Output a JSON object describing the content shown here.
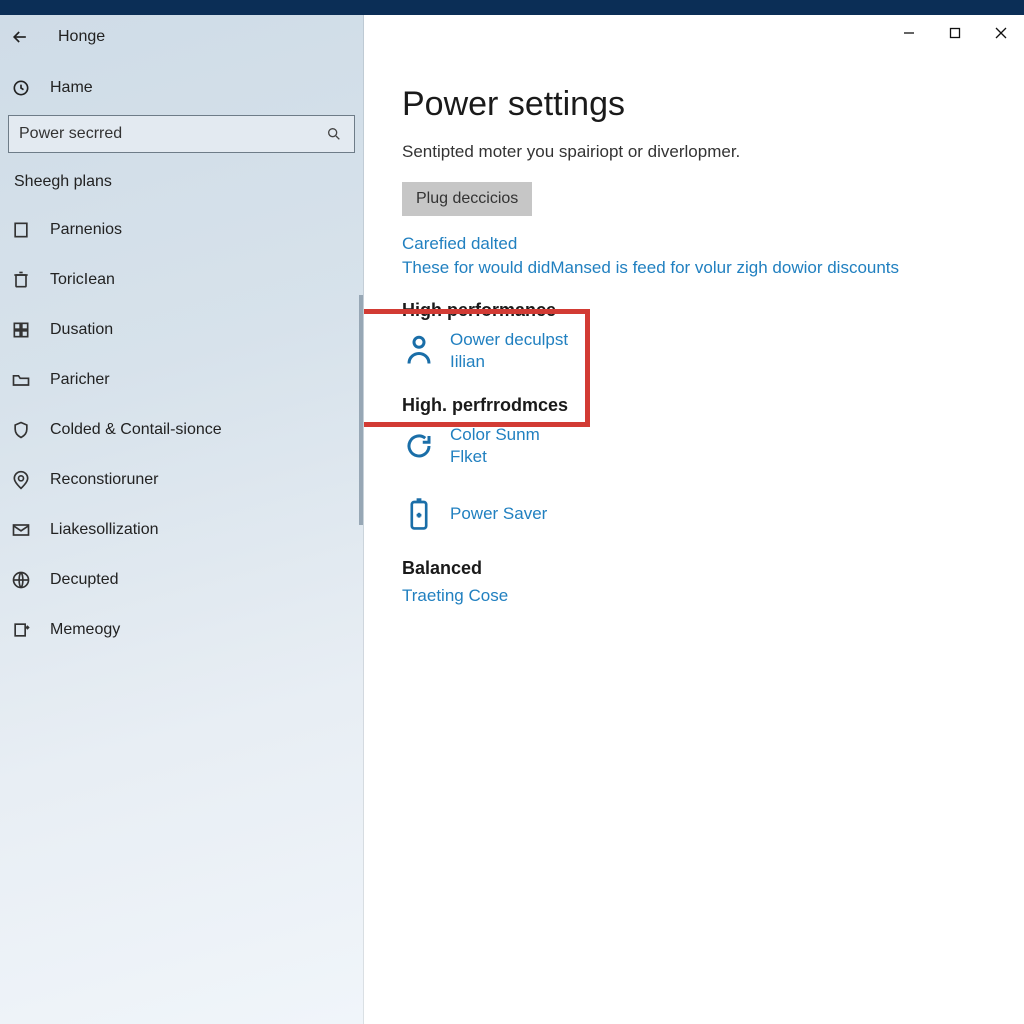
{
  "titlebar": {
    "breadcrumb": "Honge"
  },
  "sidebar": {
    "home_label": "Hame",
    "search_value": "Power secrred",
    "section_label": "Sheegh plans",
    "items": [
      {
        "label": "Parnenios"
      },
      {
        "label": "ToricIean"
      },
      {
        "label": "Dusation"
      },
      {
        "label": "Paricher"
      },
      {
        "label": "Colded & Contail-sionce"
      },
      {
        "label": "Reconstioruner"
      },
      {
        "label": "Liakesollization"
      },
      {
        "label": "Decupted"
      },
      {
        "label": "Memeogy"
      }
    ]
  },
  "main": {
    "title": "Power settings",
    "subtitle": "Sentipted moter you spairiopt or diverlopmer.",
    "button_label": "Plug deccicios",
    "link1": "Carefied dalted",
    "link2": "These for would didMansed is feed for volur zigh dowior discounts",
    "plans": [
      {
        "title": "High performance",
        "line1": "Oower deculpst",
        "line2": "Iilian"
      },
      {
        "title": "High. perfrrodmces",
        "line1": "Color Sunm",
        "line2": "Flket"
      },
      {
        "title": "",
        "line1": "Power Saver",
        "line2": ""
      },
      {
        "title": "Balanced",
        "line1": "Traeting Cose",
        "line2": ""
      }
    ]
  },
  "colors": {
    "accent": "#2180c0",
    "highlight": "#d23b34",
    "titlebar": "#0b2e56"
  }
}
